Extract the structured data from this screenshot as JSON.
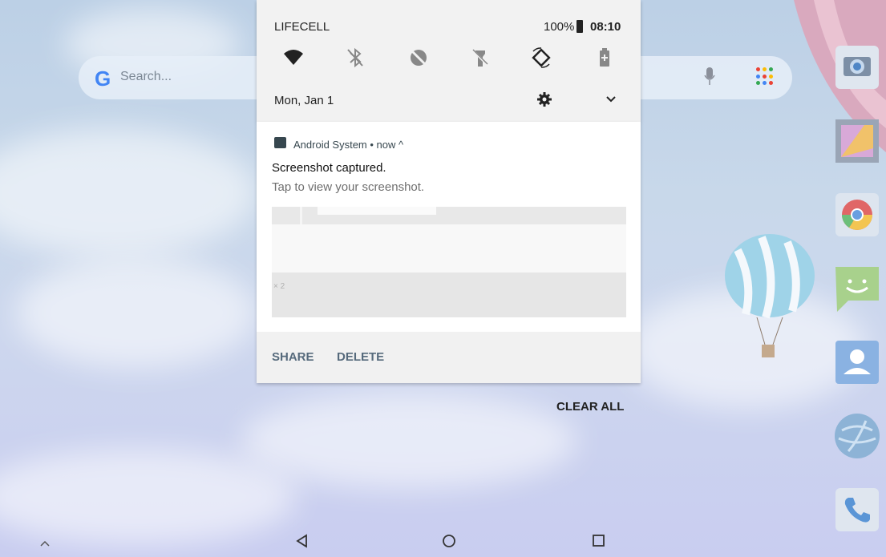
{
  "search": {
    "placeholder": "Search..."
  },
  "status_bar": {
    "carrier": "LIFECELL",
    "battery": "100%",
    "time": "08:10"
  },
  "quick_settings": {
    "tiles": [
      "wifi-icon",
      "bluetooth-off-icon",
      "data-saver-icon",
      "flashlight-off-icon",
      "auto-rotate-icon",
      "battery-saver-icon"
    ],
    "date": "Mon, Jan 1"
  },
  "notification": {
    "app_name": "Android System • now ^",
    "title": "Screenshot captured.",
    "text": "Tap to view your screenshot.",
    "preview_count": "× 2",
    "actions": {
      "share": "SHARE",
      "delete": "DELETE"
    }
  },
  "clear_all": "CLEAR ALL",
  "dock": [
    "camera-icon",
    "gallery-icon",
    "chrome-icon",
    "messaging-icon",
    "contacts-icon",
    "browser-icon",
    "phone-icon"
  ],
  "colors": {
    "accent": "#566a7c",
    "shade_bg": "#f2f2f2"
  }
}
